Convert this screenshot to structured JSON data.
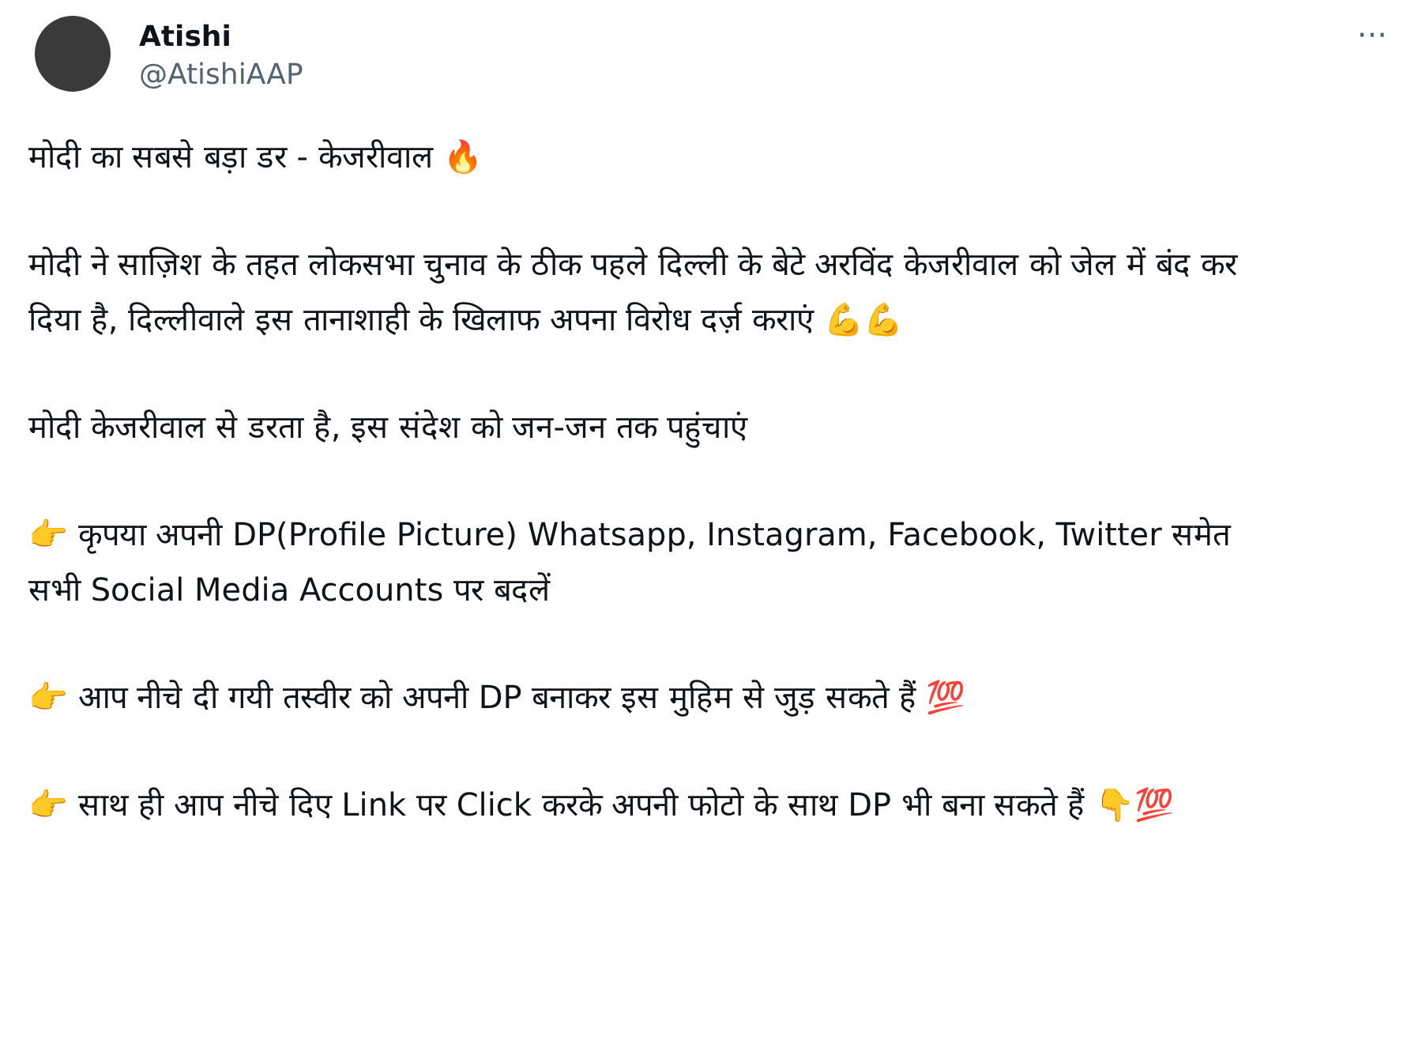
{
  "author": {
    "name": "Atishi",
    "handle": "@AtishiAAP"
  },
  "more_button": "···",
  "paragraphs": [
    "मोदी का सबसे बड़ा डर - केजरीवाल 🔥",
    "मोदी ने साज़िश के तहत लोकसभा चुनाव के ठीक पहले दिल्ली के बेटे अरविंद केजरीवाल को जेल में बंद कर दिया है, दिल्लीवाले इस तानाशाही के खिलाफ अपना विरोध दर्ज़ कराएं 💪💪",
    "मोदी केजरीवाल से डरता है, इस संदेश को जन-जन तक पहुंचाएं",
    "👉 कृपया अपनी DP(Profile Picture) Whatsapp, Instagram, Facebook, Twitter समेत सभी Social Media Accounts पर बदलें",
    "👉 आप नीचे दी गयी तस्वीर को अपनी DP बनाकर इस मुहिम से जुड़ सकते हैं 💯",
    "👉 साथ ही आप नीचे दिए Link पर Click करके अपनी फोटो के साथ DP भी बना सकते हैं 👇💯"
  ]
}
